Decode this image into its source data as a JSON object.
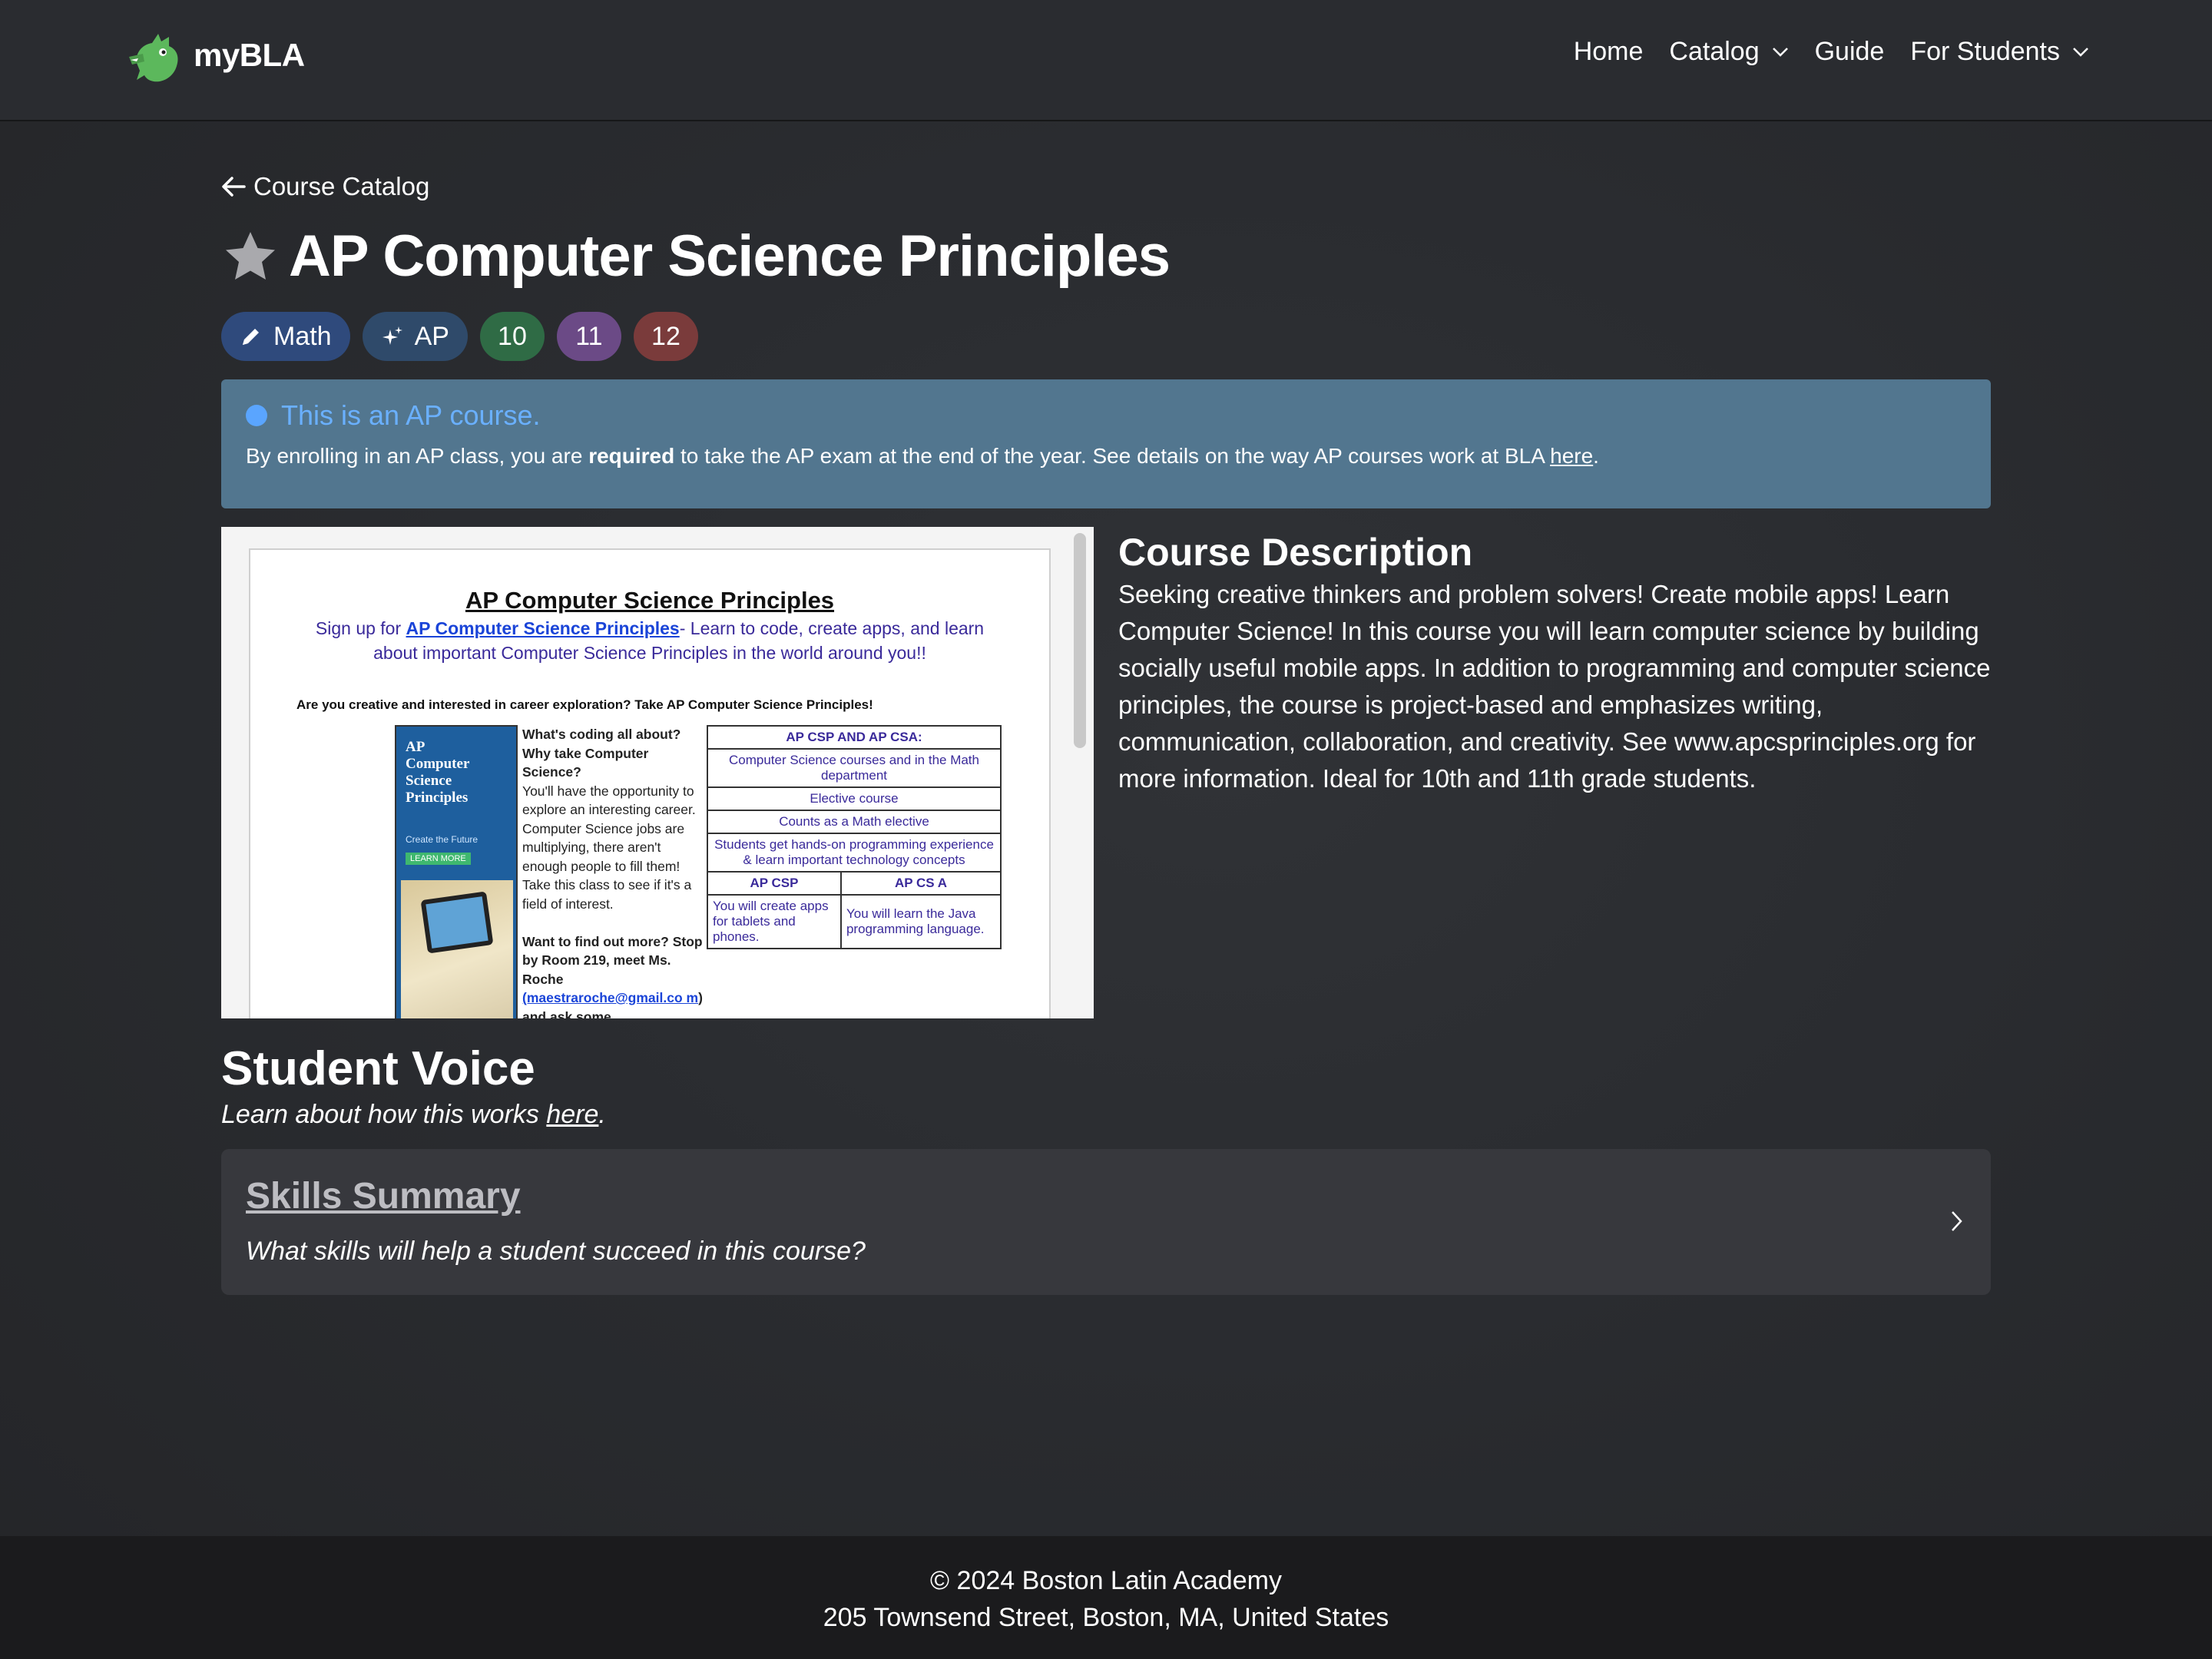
{
  "brand": {
    "name": "myBLA",
    "logo_icon": "dragon-icon"
  },
  "nav": {
    "items": [
      {
        "label": "Home",
        "dropdown": false
      },
      {
        "label": "Catalog",
        "dropdown": true
      },
      {
        "label": "Guide",
        "dropdown": false
      },
      {
        "label": "For Students",
        "dropdown": true
      }
    ]
  },
  "back_link": {
    "label": "Course Catalog",
    "icon": "arrow-left-icon"
  },
  "course": {
    "title": "AP Computer Science Principles",
    "favorite_icon": "star-icon",
    "tags": [
      {
        "label": "Math",
        "icon": "pencil-icon",
        "color": "#2f4a7c"
      },
      {
        "label": "AP",
        "icon": "sparkles-icon",
        "color": "#2f4a6a"
      },
      {
        "label": "10",
        "color": "#2f6b45"
      },
      {
        "label": "11",
        "color": "#6b4a86"
      },
      {
        "label": "12",
        "color": "#7a3b3b"
      }
    ]
  },
  "alert": {
    "heading": "This is an AP course.",
    "body_before": "By enrolling in an AP class, you are ",
    "body_bold": "required",
    "body_after": " to take the AP exam at the end of the year. See details on the way AP courses work at BLA ",
    "link": "here",
    "period": ".",
    "bg_color": "#52768f",
    "accent_color": "#6ab0ff"
  },
  "flyer": {
    "title": "AP Computer Science Principles",
    "sub_before": "Sign up for ",
    "sub_link": "AP Computer Science Principles",
    "sub_after": "- Learn to code, create apps, and learn about important Computer Science Principles in the world around you!!",
    "question": "Are you creative and interested in career exploration? Take AP Computer Science Principles!",
    "poster_title": "AP\nComputer\nScience\nPrinciples",
    "poster_tagline": "Create the Future",
    "poster_button": "LEARN MORE",
    "col_heading": "What's coding all about? Why take Computer Science?",
    "col_text": "You'll have the opportunity to explore an interesting career. Computer Science jobs are multiplying, there aren't enough people to fill them! Take this class to see if it's a field of interest.",
    "col_heading2": "Want to find out more? Stop by Room 219, meet Ms. Roche",
    "col_email": "(maestraroche@gmail.co m",
    "col_tail": ") and ask some",
    "table_header": "AP CSP AND AP CSA:",
    "table_rows": [
      "Computer Science courses and in the Math department",
      "Elective course",
      "Counts as a Math elective",
      "Students get hands-on programming experience & learn important technology concepts"
    ],
    "col_a_header": "AP CSP",
    "col_b_header": "AP CS A",
    "col_a_text": "You will create apps for tablets and phones.",
    "col_b_text": "You will learn the Java programming language."
  },
  "description": {
    "title": "Course Description",
    "body": "Seeking creative thinkers and problem solvers! Create mobile apps! Learn Computer Science! In this course you will learn computer science by building socially useful mobile apps. In addition to programming and computer science principles, the course is project-based and emphasizes writing, communication, collaboration, and creativity. See www.apcsprinciples.org for more information. Ideal for 10th and 11th grade students."
  },
  "student_voice": {
    "title": "Student Voice",
    "sub_before": "Learn about how this works ",
    "sub_link": "here",
    "sub_after": ".",
    "card_title": "Skills Summary",
    "card_sub": "What skills will help a student succeed in this course?",
    "card_icon": "chevron-right-icon"
  },
  "footer": {
    "line1": "© 2024 Boston Latin Academy",
    "line2": "205 Townsend Street, Boston, MA, United States"
  }
}
